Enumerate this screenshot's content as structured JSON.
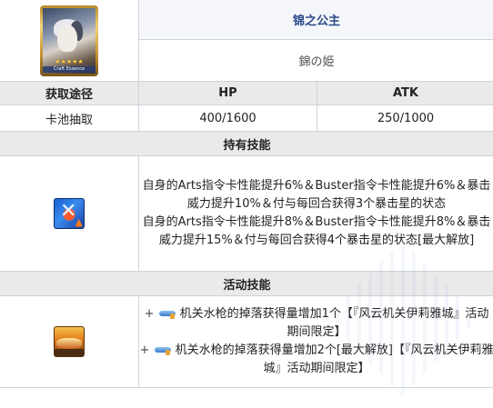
{
  "card": {
    "stars": "★★★★★",
    "label": "Craft Essence"
  },
  "title": {
    "name_cn": "锦之公主",
    "name_jp": "錦の姫"
  },
  "stats_header": {
    "obtain": "获取途径",
    "hp": "HP",
    "atk": "ATK"
  },
  "stats": {
    "obtain": "卡池抽取",
    "hp": "400/1600",
    "atk": "250/1000"
  },
  "sections": {
    "passive": "持有技能",
    "event": "活动技能"
  },
  "passive": {
    "icon": "buster-arts-up-icon",
    "line1": "自身的Arts指令卡性能提升6%＆Buster指令卡性能提升6%＆暴击威力提升10%＆付与每回合获得3个暴击星的状态",
    "line2": "自身的Arts指令卡性能提升8%＆Buster指令卡性能提升8%＆暴击威力提升15%＆付与每回合获得4个暴击星的状态[最大解放]"
  },
  "event": {
    "icon": "event-bonus-icon",
    "item_icon": "water-gun-icon",
    "line1_plus": "+",
    "line1": "机关水枪的掉落获得量增加1个【『风云机关伊莉雅城』活动期间限定】",
    "line2_plus": "+",
    "line2": "机关水枪的掉落获得量增加2个[最大解放]【『风云机关伊莉雅城』活动期间限定】"
  }
}
